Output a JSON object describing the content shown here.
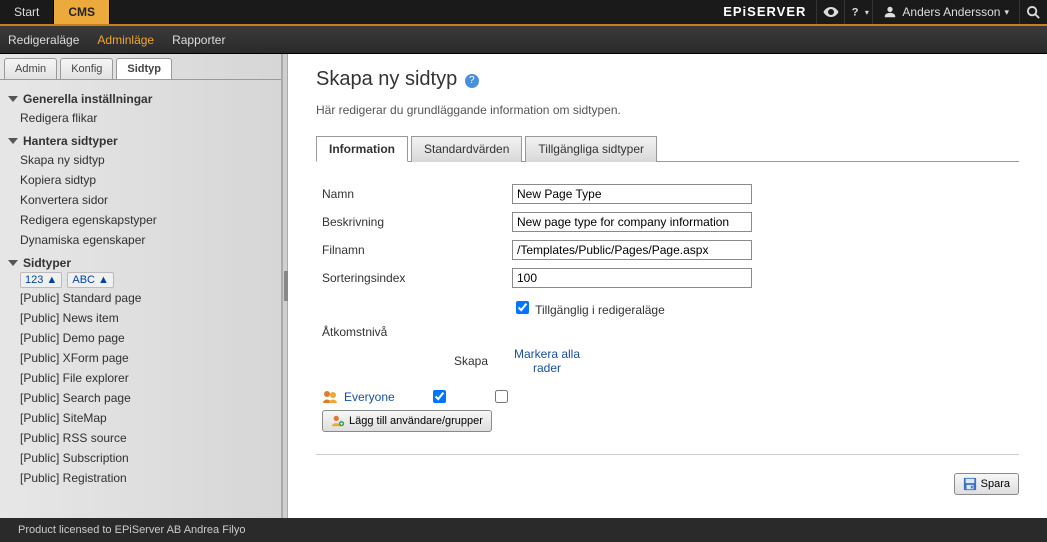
{
  "topbar": {
    "start": "Start",
    "cms": "CMS",
    "brand": "EPiSERVER",
    "user": "Anders Andersson"
  },
  "subnav": {
    "edit": "Redigeraläge",
    "admin": "Adminläge",
    "reports": "Rapporter"
  },
  "sidebar": {
    "tabs": {
      "admin": "Admin",
      "konfig": "Konfig",
      "sidtyp": "Sidtyp"
    },
    "sections": {
      "general": "Generella inställningar",
      "general_items": [
        "Redigera flikar"
      ],
      "manage": "Hantera sidtyper",
      "manage_items": [
        "Skapa ny sidtyp",
        "Kopiera sidtyp",
        "Konvertera sidor",
        "Redigera egenskapstyper",
        "Dynamiska egenskaper"
      ],
      "types": "Sidtyper",
      "sort123": "123 ▲",
      "sortabc": "ABC ▲",
      "type_items": [
        "[Public] Standard page",
        "[Public] News item",
        "[Public] Demo page",
        "[Public] XForm page",
        "[Public] File explorer",
        "[Public] Search page",
        "[Public] SiteMap",
        "[Public] RSS source",
        "[Public] Subscription",
        "[Public] Registration"
      ]
    }
  },
  "page": {
    "title": "Skapa ny sidtyp",
    "description": "Här redigerar du grundläggande information om sidtypen.",
    "tabs": {
      "info": "Information",
      "defaults": "Standardvärden",
      "avail": "Tillgängliga sidtyper"
    },
    "fields": {
      "name_lbl": "Namn",
      "name_val": "New Page Type",
      "desc_lbl": "Beskrivning",
      "desc_val": "New page type for company information",
      "file_lbl": "Filnamn",
      "file_val": "/Templates/Public/Pages/Page.aspx",
      "sort_lbl": "Sorteringsindex",
      "sort_val": "100",
      "avail_chk": "Tillgänglig i redigeraläge"
    },
    "access": {
      "heading": "Åtkomstnivå",
      "create_col": "Skapa",
      "markall": "Markera alla rader",
      "everyone": "Everyone",
      "addbtn": "Lägg till användare/grupper"
    },
    "save": "Spara"
  },
  "footer": {
    "license": "Product licensed to EPiServer AB Andrea Filyo"
  }
}
